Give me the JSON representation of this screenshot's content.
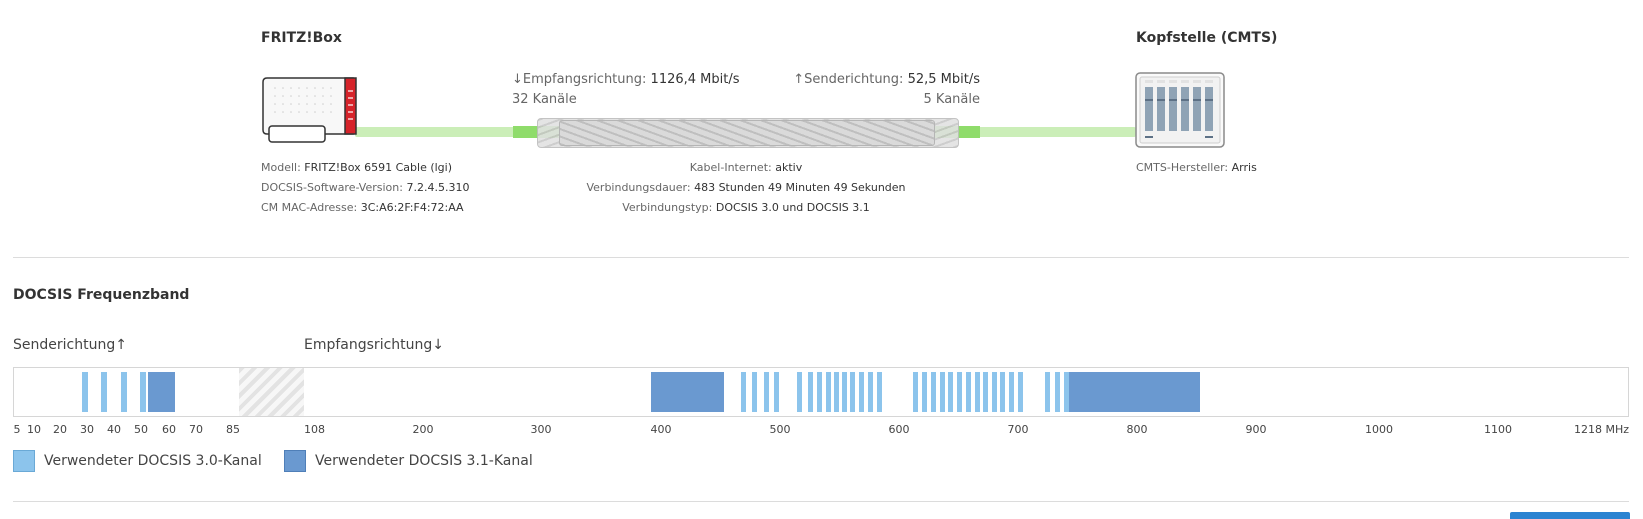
{
  "device": {
    "title": "FRITZ!Box",
    "model_label": "Modell:",
    "model_value": "FRITZ!Box 6591 Cable (lgi)",
    "docsis_label": "DOCSIS-Software-Version:",
    "docsis_value": "7.2.4.5.310",
    "mac_label": "CM MAC-Adresse:",
    "mac_value": "3C:A6:2F:F4:72:AA"
  },
  "link": {
    "down_arrow": "↓",
    "down_label": "Empfangsrichtung:",
    "down_value": "1126,4 Mbit/s",
    "down_channels": "32 Kanäle",
    "up_arrow": "↑",
    "up_label": "Senderichtung:",
    "up_value": "52,5 Mbit/s",
    "up_channels": "5 Kanäle",
    "internet_label": "Kabel-Internet:",
    "internet_value": "aktiv",
    "duration_label": "Verbindungsdauer:",
    "duration_value": "483 Stunden 49 Minuten 49 Sekunden",
    "type_label": "Verbindungstyp:",
    "type_value": "DOCSIS 3.0 und DOCSIS 3.1"
  },
  "cmts": {
    "title": "Kopfstelle (CMTS)",
    "vendor_label": "CMTS-Hersteller:",
    "vendor_value": "Arris"
  },
  "band": {
    "title": "DOCSIS Frequenzband",
    "up_label": "Senderichtung↑",
    "down_label": "Empfangsrichtung↓",
    "ticks": [
      "5",
      "10",
      "20",
      "30",
      "40",
      "50",
      "60",
      "70",
      "85",
      "108",
      "200",
      "300",
      "400",
      "500",
      "600",
      "700",
      "800",
      "900",
      "1000",
      "1100",
      "1218 MHz"
    ]
  },
  "legend": {
    "docsis30": "Verwendeter DOCSIS 3.0-Kanal",
    "docsis31": "Verwendeter DOCSIS 3.1-Kanal"
  },
  "colors": {
    "docsis30": "#8cc4ec",
    "docsis31": "#6a99d0",
    "cable": "#9be07a",
    "accent": "#2a83d1"
  }
}
